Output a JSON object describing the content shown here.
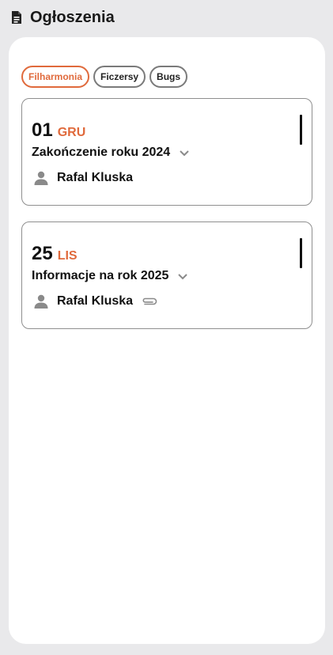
{
  "header": {
    "title": "Ogłoszenia",
    "icon": "document-icon"
  },
  "filters": [
    {
      "label": "Filharmonia",
      "active": true
    },
    {
      "label": "Ficzersy",
      "active": false
    },
    {
      "label": "Bugs",
      "active": false
    }
  ],
  "announcements": [
    {
      "day": "01",
      "month": "GRU",
      "title": "Zakończenie roku 2024",
      "author": "Rafal Kluska",
      "has_attachment": false
    },
    {
      "day": "25",
      "month": "LIS",
      "title": "Informacje na rok 2025",
      "author": "Rafal Kluska",
      "has_attachment": true
    }
  ],
  "colors": {
    "accent": "#e06a3c",
    "background": "#e9e9eb",
    "panel": "#ffffff",
    "icon_gray": "#8a8a8a"
  }
}
